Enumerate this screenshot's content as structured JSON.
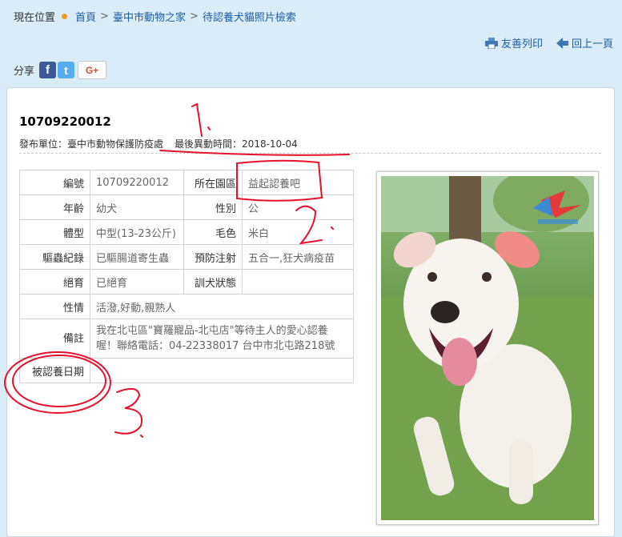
{
  "breadcrumb": {
    "here": "現在位置",
    "items": [
      "首頁",
      "臺中市動物之家",
      "待認養犬貓照片檢索"
    ],
    "sep": ">"
  },
  "tools": {
    "print": "友善列印",
    "back": "回上一頁"
  },
  "share": {
    "label": "分享",
    "facebook": "f",
    "twitter": "t",
    "google": "G+"
  },
  "record": {
    "id": "10709220012",
    "publisher_label": "發布單位：",
    "publisher": "臺中市動物保護防疫處",
    "updated_label": "最後異動時間：",
    "updated": "2018-10-04"
  },
  "info": {
    "id_label": "編號",
    "id_value": "10709220012",
    "area_label": "所在園區",
    "area_value": "益起認養吧",
    "age_label": "年齡",
    "age_value": "幼犬",
    "sex_label": "性別",
    "sex_value": "公",
    "size_label": "體型",
    "size_value": "中型(13-23公斤)",
    "color_label": "毛色",
    "color_value": "米白",
    "deworm_label": "驅蟲紀錄",
    "deworm_value": "已驅腸道寄生蟲",
    "vaccine_label": "預防注射",
    "vaccine_value": "五合一,狂犬病疫苗",
    "neuter_label": "絕育",
    "neuter_value": "已絕育",
    "training_label": "訓犬狀態",
    "training_value": "",
    "temper_label": "性情",
    "temper_value": "活潑,好動,親熟人",
    "memo_label": "備註",
    "memo_value": "我在北屯區\"寶羅寵品-北屯店\"等待主人的愛心認養喔！聯絡電話：04-22338017 台中市北屯路218號",
    "adopt_date_label": "被認養日期",
    "adopt_date_value": ""
  },
  "annotations": {
    "one": "1",
    "two": "2",
    "three": "3"
  },
  "colors": {
    "background": "#d9ecf8",
    "link": "#1a5fa5",
    "dot": "#f39a1e",
    "annotation": "#e8102a"
  }
}
